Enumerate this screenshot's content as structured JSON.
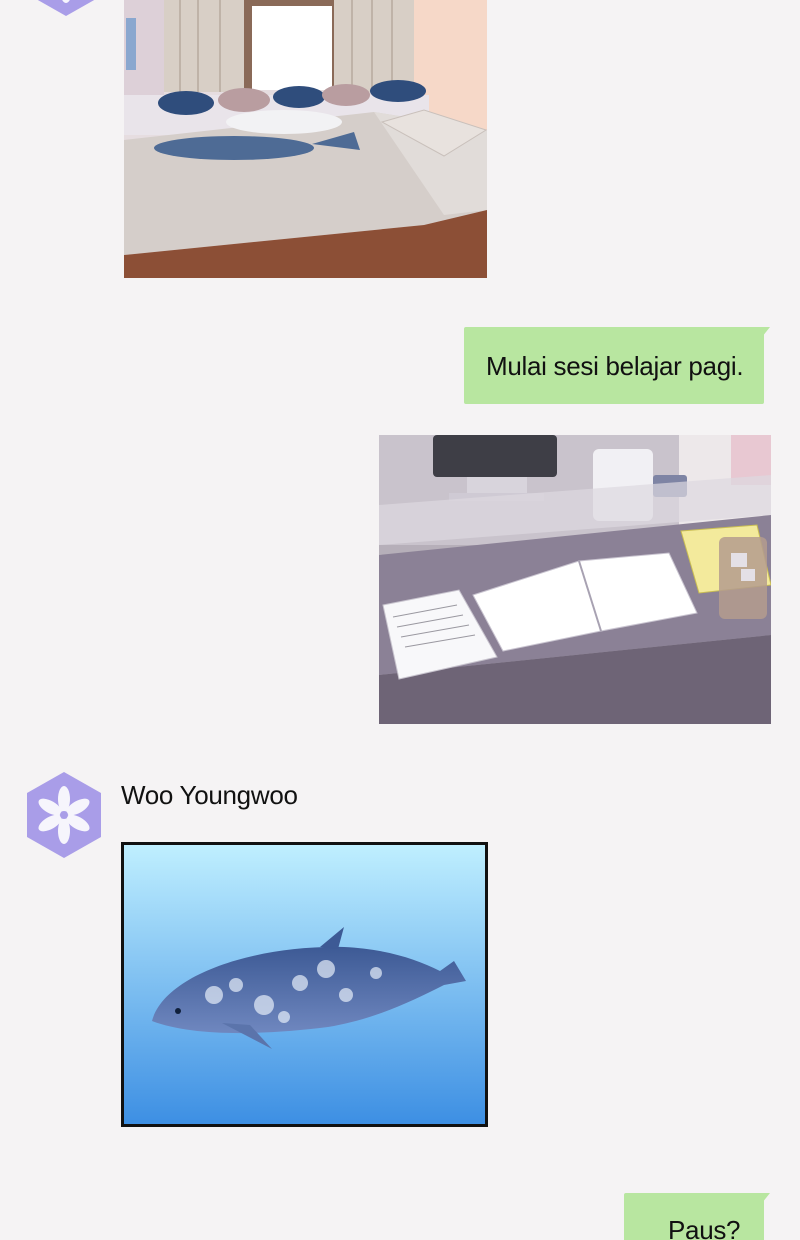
{
  "messages": [
    {
      "type": "image",
      "direction": "incoming",
      "description_icon": "bedroom-image"
    },
    {
      "type": "text",
      "direction": "outgoing",
      "text": "Mulai sesi belajar pagi."
    },
    {
      "type": "image",
      "direction": "outgoing",
      "description_icon": "desk-study-image"
    },
    {
      "type": "image",
      "direction": "incoming",
      "sender": "Woo Youngwoo",
      "description_icon": "whale-image"
    },
    {
      "type": "text",
      "direction": "outgoing",
      "text": "Paus?"
    }
  ],
  "colors": {
    "background": "#f5f3f4",
    "outgoing_bubble": "#b8e6a0",
    "avatar": "#a99de8"
  }
}
